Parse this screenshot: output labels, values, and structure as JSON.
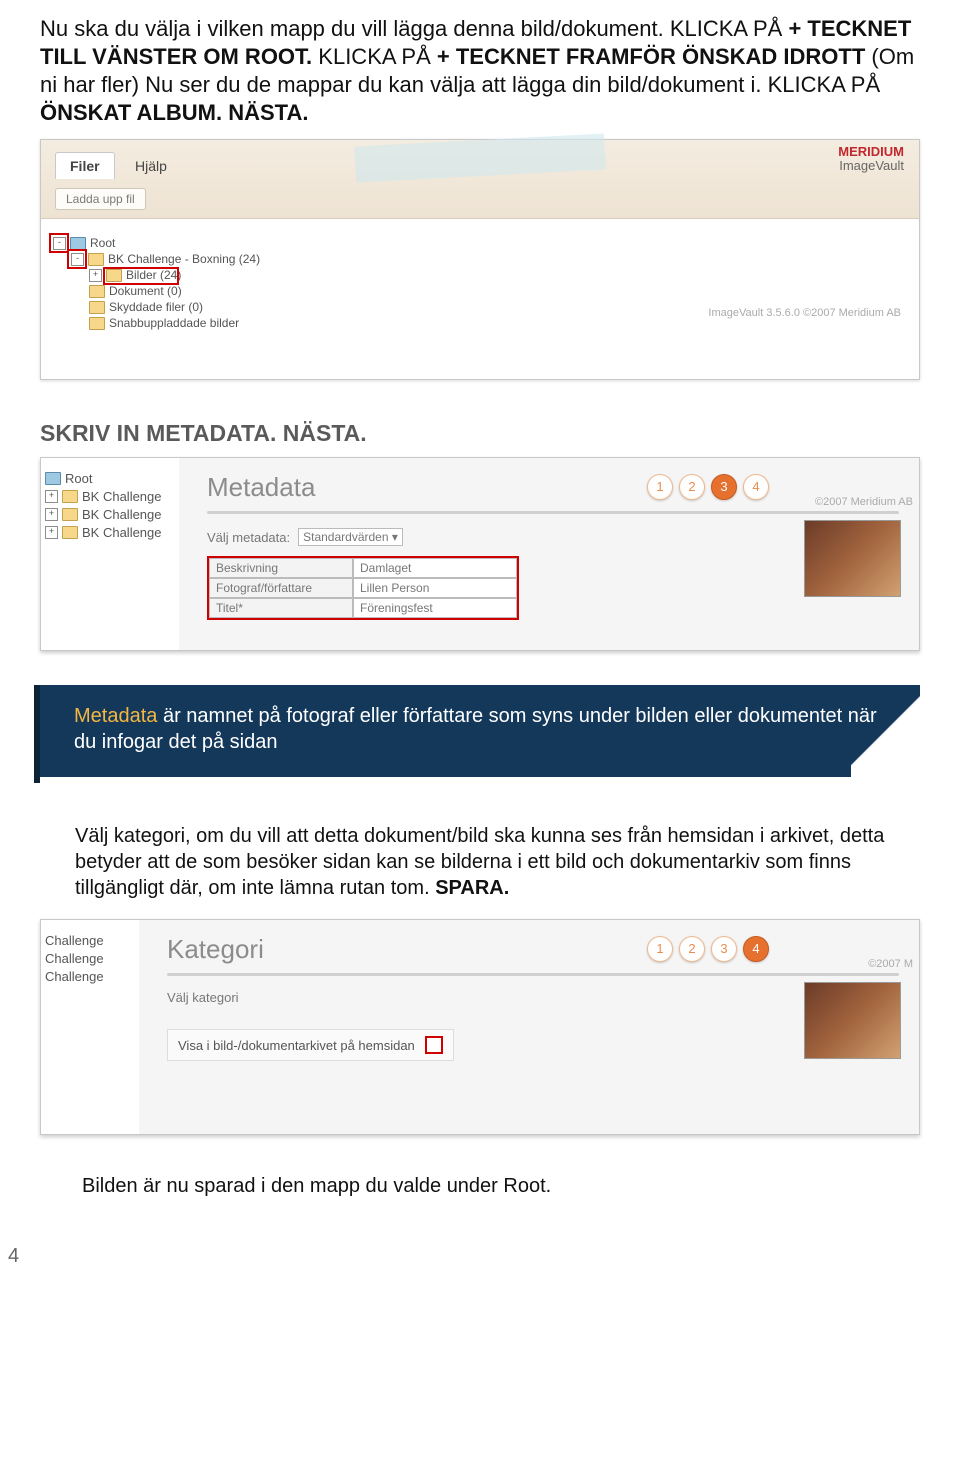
{
  "intro": {
    "line1a": "Nu ska du välja i vilken mapp du vill lägga denna bild/dokument. KLICKA PÅ ",
    "line1b": "+ TECKNET TILL VÄNSTER OM ROOT.",
    "line2a": " KLICKA PÅ ",
    "line2b": "+ TECKNET FRAMFÖR ÖNSKAD IDROTT ",
    "line2c": "(Om ni har fler) Nu ser du de mappar du kan välja att lägga din bild/dokument i. KLICKA PÅ ",
    "line2d": "ÖNSKAT ALBUM. NÄSTA."
  },
  "fig1": {
    "tab1": "Filer",
    "tab2": "Hjälp",
    "upload": "Ladda upp fil",
    "logo_top": "MERIDIUM",
    "logo_bot": "ImageVault",
    "root": "Root",
    "item1": "BK Challenge - Boxning (24)",
    "item2": "Bilder (24)",
    "item3": "Dokument (0)",
    "item4": "Skyddade filer (0)",
    "item5": "Snabbuppladdade bilder",
    "watermark": "ImageVault 3.5.6.0 ©2007 Meridium AB"
  },
  "section2_heading": "SKRIV IN METADATA. NÄSTA.",
  "fig2": {
    "side_root": "Root",
    "side_item": "BK Challenge",
    "title": "Metadata",
    "copyright": "©2007 Meridium AB",
    "select_label": "Välj metadata:",
    "select_value": "Standardvärden",
    "steps": [
      "1",
      "2",
      "3",
      "4"
    ],
    "rows": [
      {
        "label": "Beskrivning",
        "value": "Damlaget"
      },
      {
        "label": "Fotograf/författare",
        "value": "Lillen Person"
      },
      {
        "label": "Titel*",
        "value": "Föreningsfest"
      }
    ]
  },
  "callout": {
    "accent": "Metadata",
    "text": " är namnet på fotograf eller författare som syns under bilden eller dokumentet när du infogar det på sidan"
  },
  "para3": {
    "body": "Välj  kategori, om du vill att detta dokument/bild ska kunna ses från hemsidan i arkivet, detta betyder att de som besöker sidan kan se bilderna i ett bild och dokumentarkiv som finns tillgängligt där, om inte lämna rutan tom. ",
    "bold": "SPARA."
  },
  "fig3": {
    "side_item": "Challenge",
    "title": "Kategori",
    "sub": "Välj kategori",
    "check_label": "Visa i bild-/dokumentarkivet på hemsidan",
    "copyright": "©2007 M",
    "steps": [
      "1",
      "2",
      "3",
      "4"
    ]
  },
  "footer": "Bilden är nu sparad i den mapp du valde under Root.",
  "page_number": "4"
}
